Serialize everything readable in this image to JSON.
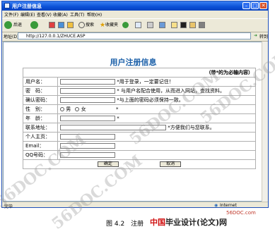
{
  "window": {
    "title": "用户注册信息",
    "menu": [
      "文件(F)",
      "编辑(E)",
      "查看(V)",
      "收藏(A)",
      "工具(T)",
      "帮助(H)"
    ],
    "toolbar": {
      "back": "后退",
      "search": "搜索",
      "favorites": "收藏夹"
    },
    "address_label": "地址(D)",
    "address": "http://127.0.0.1/ZHUCE.ASP",
    "go": "转到"
  },
  "page": {
    "heading": "用户注册信息",
    "required_note": "（带*的为必输内容）",
    "fields": [
      {
        "label": "用户名：",
        "note": "*用于登录，一定要记住！"
      },
      {
        "label": "密　码：",
        "note": "* 与用户名配合使用，从而进入网站，查找资料。"
      },
      {
        "label": "确认密码：",
        "note": "*与上面的密码必须保持一致。"
      },
      {
        "label": "性　别：",
        "options": [
          "男",
          "女"
        ],
        "note": "*"
      },
      {
        "label": "年　龄：",
        "note": "*"
      },
      {
        "label": "联系地址：",
        "note": "*方便我们与您联系。"
      },
      {
        "label": "个人主页：",
        "note": ""
      },
      {
        "label": "Email：",
        "note": ""
      },
      {
        "label": "QQ号码：",
        "note": ""
      }
    ],
    "submit": "确定",
    "cancel": "取消"
  },
  "status": {
    "left": "完毕",
    "zone": "Internet"
  },
  "caption": "图 4.2　注册",
  "logo": {
    "red": "中国",
    "text": "毕业设计(论文)网"
  },
  "site_url": "56DOC.com",
  "watermark": "56DOC.COM"
}
